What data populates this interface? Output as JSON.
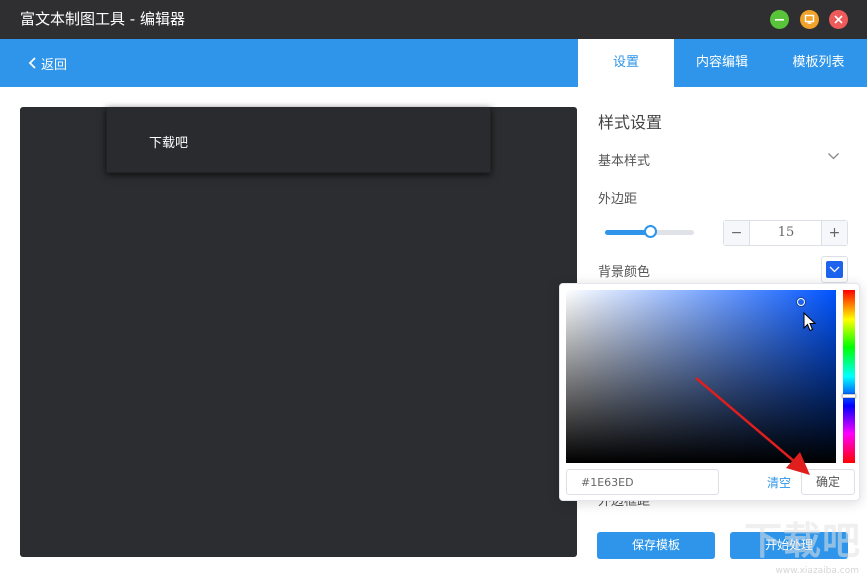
{
  "window": {
    "title": "富文本制图工具 - 编辑器",
    "controls": {
      "min_color": "#58c43a",
      "max_color": "#f0a22a",
      "close_color": "#ef5b5b"
    }
  },
  "nav": {
    "back_label": "返回",
    "tabs": [
      {
        "label": "设置",
        "active": true
      },
      {
        "label": "内容编辑",
        "active": false
      },
      {
        "label": "模板列表",
        "active": false
      }
    ],
    "accent_color": "#2e95ea"
  },
  "canvas": {
    "background": "#2c2d30",
    "card_text": "下载吧"
  },
  "settings": {
    "title": "样式设置",
    "basic_style_label": "基本样式",
    "margin_label": "外边距",
    "margin_slider_fraction": 0.5,
    "margin_value": "15",
    "minus": "−",
    "plus": "+",
    "bg_color_label": "背景颜色",
    "bg_color": "#1E63ED",
    "obscured_label": "外边框距"
  },
  "picker": {
    "hex_value": "#1E63ED",
    "clear_label": "清空",
    "confirm_label": "确定",
    "saturation": 0.87,
    "brightness": 0.93,
    "hue_fraction": 0.612
  },
  "buttons": {
    "save_template": "保存模板",
    "start_process": "开始处理"
  },
  "watermark": {
    "big": "下载吧",
    "small": "www.xiazaiba.com"
  }
}
